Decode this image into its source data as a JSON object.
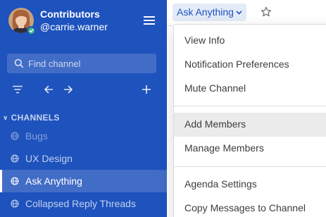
{
  "team": {
    "name": "Contributors",
    "username": "@carrie.warner"
  },
  "search": {
    "placeholder": "Find channel"
  },
  "sections": {
    "channels_label": "CHANNELS"
  },
  "channels": [
    {
      "label": "Bugs",
      "state": "muted",
      "icon": "globe-icon"
    },
    {
      "label": "UX Design",
      "state": "normal",
      "icon": "globe-icon"
    },
    {
      "label": "Ask Anything",
      "state": "active",
      "icon": "globe-icon"
    },
    {
      "label": "Collapsed Reply Threads",
      "state": "normal",
      "icon": "globe-icon"
    }
  ],
  "header": {
    "channel_title": "Ask Anything"
  },
  "channel_menu": {
    "items": [
      {
        "label": "View Info"
      },
      {
        "label": "Notification Preferences"
      },
      {
        "label": "Mute Channel"
      },
      {
        "label": "Add Members"
      },
      {
        "label": "Manage Members"
      },
      {
        "label": "Agenda Settings"
      },
      {
        "label": "Copy Messages to Channel"
      }
    ]
  },
  "colors": {
    "sidebar_bg": "#1e52bd",
    "accent": "#1e52bd",
    "online_status": "#3db887"
  }
}
